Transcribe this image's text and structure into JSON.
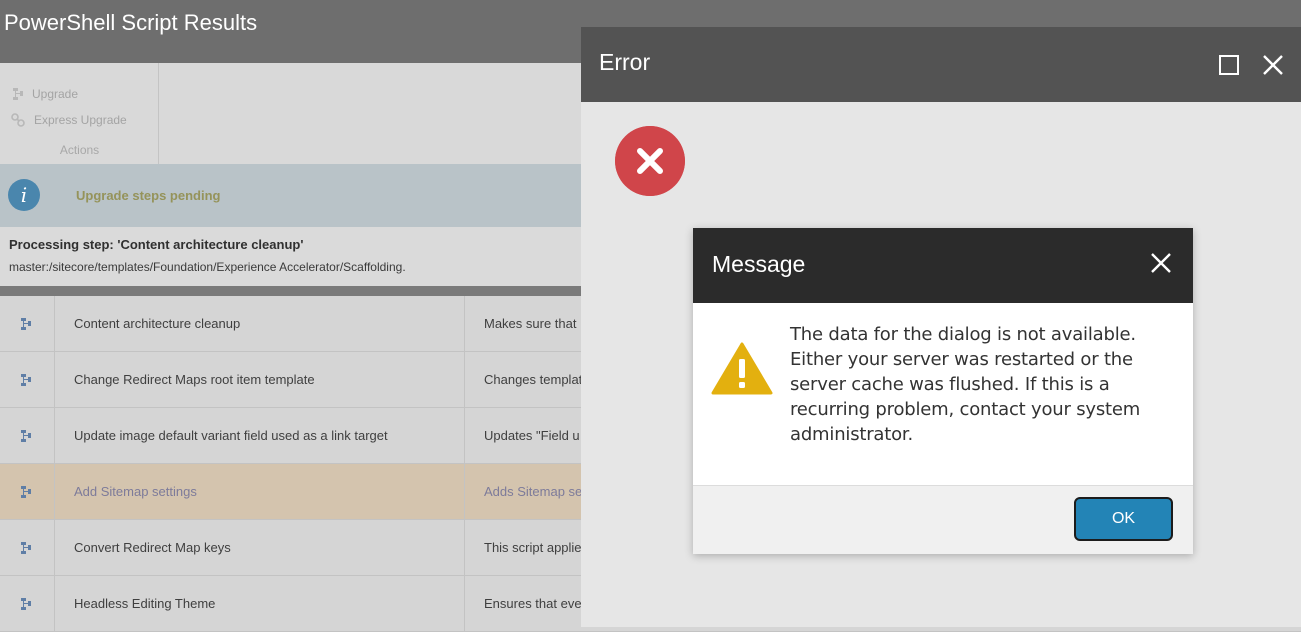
{
  "window": {
    "title": "PowerShell Script Results"
  },
  "ribbon": {
    "actions": [
      {
        "label": "Upgrade",
        "icon": "upgrade-icon"
      },
      {
        "label": "Express Upgrade",
        "icon": "express-upgrade-icon"
      }
    ],
    "group_label": "Actions"
  },
  "info_bar": {
    "icon": "info-icon",
    "text": "Upgrade steps pending"
  },
  "progress": {
    "title": "Processing step: 'Content architecture cleanup'",
    "path": "master:/sitecore/templates/Foundation/Experience Accelerator/Scaffolding."
  },
  "steps": [
    {
      "name": "Content architecture cleanup",
      "description": "Makes sure that"
    },
    {
      "name": "Change Redirect Maps root item template",
      "description": "Changes templat"
    },
    {
      "name": "Update image default variant field used as a link target",
      "description": "Updates \"Field u"
    },
    {
      "name": "Add Sitemap settings",
      "description": "Adds Sitemap se",
      "highlighted": true
    },
    {
      "name": "Convert Redirect Map keys",
      "description": "This script applie"
    },
    {
      "name": "Headless Editing Theme",
      "description": "Ensures that eve"
    }
  ],
  "error_dialog": {
    "title": "Error",
    "icons": [
      "maximize-icon",
      "close-icon",
      "error-x-icon"
    ]
  },
  "message_dialog": {
    "title": "Message",
    "text": "The data for the dialog is not available. Either your server was restarted or the server cache was flushed. If this is a recurring problem, contact your system administrator.",
    "ok_label": "OK",
    "icons": [
      "close-icon",
      "warning-icon"
    ]
  },
  "colors": {
    "titlebar": "#6e6e6e",
    "info_bar": "#b9c3c8",
    "error_header": "#535353",
    "error_badge": "#d0454a",
    "message_header": "#2b2b2b",
    "warning": "#e3b00f",
    "ok_button": "#2384b6",
    "highlight_row": "#d4c4ae"
  }
}
